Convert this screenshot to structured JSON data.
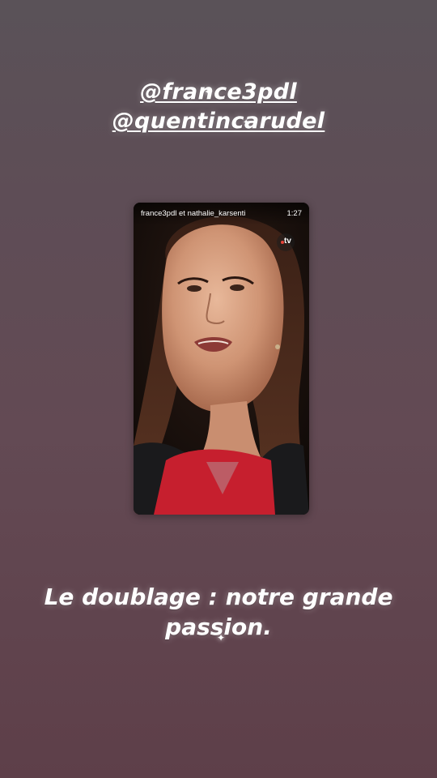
{
  "story": {
    "mentions": [
      "@france3pdl",
      "@quentincarudel"
    ],
    "caption": {
      "line1": "Le doublage : notre grande",
      "line2": "passion."
    },
    "shared_post": {
      "account": "france3pdl et nathalie_karsenti",
      "duration": "1:27",
      "channel_logo": {
        "text": "tv",
        "icon": "france-tv-logo-icon",
        "dot_color": "#e8443a"
      }
    },
    "colors": {
      "background_top": "#5a5258",
      "background_bottom": "#5e3f49",
      "text": "#ffffff"
    }
  }
}
